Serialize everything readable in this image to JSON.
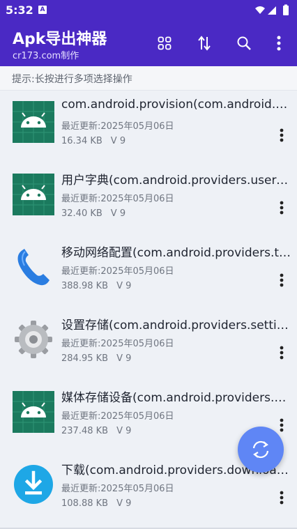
{
  "status": {
    "time": "5:32",
    "badge": "A"
  },
  "app": {
    "title": "Apk导出神器",
    "subtitle": "cr173.com制作"
  },
  "toolbar": {
    "icons": [
      "grid-icon",
      "sort-icon",
      "search-icon",
      "more-vert-icon"
    ]
  },
  "hint": "提示:长按进行多项选择操作",
  "apps": [
    {
      "title": "com.android.provision(com.android.provision)",
      "updated": "最近更新:2025年05月06日",
      "size": "16.34 KB",
      "version": "V 9",
      "icon": "android-icon"
    },
    {
      "title": "用户字典(com.android.providers.userdictionary)",
      "updated": "最近更新:2025年05月06日",
      "size": "32.40 KB",
      "version": "V 9",
      "icon": "android-icon"
    },
    {
      "title": "移动网络配置(com.android.providers.telephony)",
      "updated": "最近更新:2025年05月06日",
      "size": "388.98 KB",
      "version": "V 9",
      "icon": "phone-icon"
    },
    {
      "title": "设置存储(com.android.providers.settings)",
      "updated": "最近更新:2025年05月06日",
      "size": "284.95 KB",
      "version": "V 9",
      "icon": "settings-gear-icon"
    },
    {
      "title": "媒体存储设备(com.android.providers.media)",
      "updated": "最近更新:2025年05月06日",
      "size": "237.48 KB",
      "version": "V 9",
      "icon": "android-icon"
    },
    {
      "title": "下载(com.android.providers.downloads)",
      "updated": "最近更新:2025年05月06日",
      "size": "108.88 KB",
      "version": "V 9",
      "icon": "download-icon"
    }
  ],
  "fab": {
    "icon": "refresh-icon"
  },
  "colors": {
    "primary": "#4a29c4",
    "fab": "#5f86f5",
    "android_tile": "#1b7a5e"
  }
}
